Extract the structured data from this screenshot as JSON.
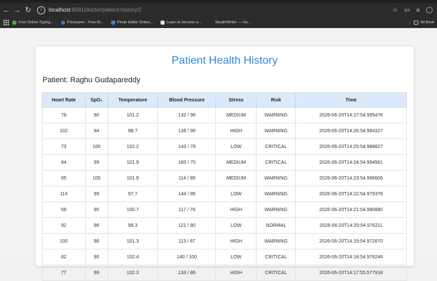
{
  "browser": {
    "url_host": "localhost",
    "url_path": ":8081/doctor/patient-history/2",
    "bookmarks": [
      {
        "label": "Free Online Typing...",
        "color": "#3fae3f"
      },
      {
        "label": "Pixcleaner - Free AI...",
        "color": "#3b6fe0"
      },
      {
        "label": "Photo Editor Online...",
        "color": "#3d7ce0"
      },
      {
        "label": "Learn to become a...",
        "color": "#e0e0e0"
      },
      {
        "label": "StealthWriter — Hu...",
        "color": "#9a9a9a"
      }
    ],
    "all_bookmarks": "All Book"
  },
  "page": {
    "title": "Patient Health History",
    "patient_label": "Patient: Raghu Gudapareddy"
  },
  "table": {
    "headers": [
      "Heart Rate",
      "SpO₂",
      "Temperature",
      "Blood Pressure",
      "Stress",
      "Risk",
      "Time"
    ],
    "rows": [
      [
        "78",
        "90",
        "101.2",
        "132 / 96",
        "MEDIUM",
        "WARNING",
        "2026-06-20T14:27:54.995476"
      ],
      [
        "102",
        "94",
        "98.7",
        "136 / 95",
        "HIGH",
        "WARNING",
        "2026-06-20T14:26:54.984327"
      ],
      [
        "73",
        "100",
        "102.2",
        "143 / 79",
        "LOW",
        "CRITICAL",
        "2026-06-20T14:25:54.988827"
      ],
      [
        "84",
        "99",
        "101.9",
        "160 / 70",
        "MEDIUM",
        "CRITICAL",
        "2026-06-20T14:24:54.994561"
      ],
      [
        "65",
        "100",
        "101.9",
        "114 / 89",
        "MEDIUM",
        "WARNING",
        "2026-06-20T14:23:54.986606"
      ],
      [
        "114",
        "99",
        "97.7",
        "144 / 86",
        "LOW",
        "WARNING",
        "2026-06-20T14:22:54.979378"
      ],
      [
        "68",
        "95",
        "100.7",
        "117 / 76",
        "HIGH",
        "WARNING",
        "2026-06-20T14:21:54.980880"
      ],
      [
        "92",
        "98",
        "98.3",
        "121 / 80",
        "LOW",
        "NORMAL",
        "2026-06-20T14:20:54.976211"
      ],
      [
        "100",
        "98",
        "101.3",
        "113 / 87",
        "HIGH",
        "WARNING",
        "2026-06-20T14:19:54.972670"
      ],
      [
        "82",
        "90",
        "102.4",
        "140 / 100",
        "LOW",
        "CRITICAL",
        "2026-06-20T14:18:54.976246"
      ],
      [
        "77",
        "99",
        "102.3",
        "133 / 86",
        "HIGH",
        "CRITICAL",
        "2026-06-20T14:17:55.577918"
      ]
    ]
  }
}
